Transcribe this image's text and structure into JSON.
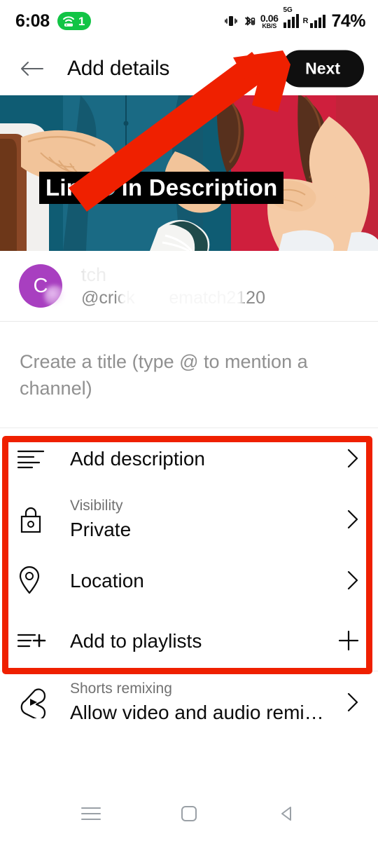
{
  "status_bar": {
    "time": "6:08",
    "hotspot_count": "1",
    "hotspot_icon": "wifi-hotspot-icon",
    "vibrate_icon": "vibrate-icon",
    "bluetooth_icon": "bluetooth-icon",
    "net_speed_value": "0.06",
    "net_speed_unit": "KB/S",
    "network_type": "5G",
    "sim2_label": "R",
    "battery": "74%"
  },
  "header": {
    "back_icon": "back-arrow-icon",
    "title": "Add details",
    "next_label": "Next"
  },
  "thumbnail": {
    "caption_before": "Link",
    "caption_after": "in  Description"
  },
  "channel": {
    "avatar_letter": "C",
    "name": "tch",
    "handle": "@crick       ematch2120"
  },
  "title_field": {
    "placeholder": "Create a title (type @ to mention a channel)"
  },
  "options": [
    {
      "icon": "description-lines-icon",
      "sub": "",
      "label": "Add description",
      "trail": "chevron-right-icon"
    },
    {
      "icon": "lock-icon",
      "sub": "Visibility",
      "label": "Private",
      "trail": "chevron-right-icon"
    },
    {
      "icon": "location-pin-icon",
      "sub": "",
      "label": "Location",
      "trail": "chevron-right-icon"
    },
    {
      "icon": "playlist-add-icon",
      "sub": "",
      "label": "Add to playlists",
      "trail": "plus-icon"
    },
    {
      "icon": "shorts-remix-icon",
      "sub": "Shorts remixing",
      "label": "Allow video and audio remixi…",
      "trail": "chevron-right-icon"
    }
  ],
  "navbar": {
    "recents_icon": "recents-menu-icon",
    "home_icon": "home-square-icon",
    "back_icon": "back-triangle-icon"
  },
  "colors": {
    "annotation_red": "#ef2000",
    "avatar_purple": "#a83fc0",
    "hotspot_green": "#12c445",
    "next_button": "#0f0f0f"
  }
}
